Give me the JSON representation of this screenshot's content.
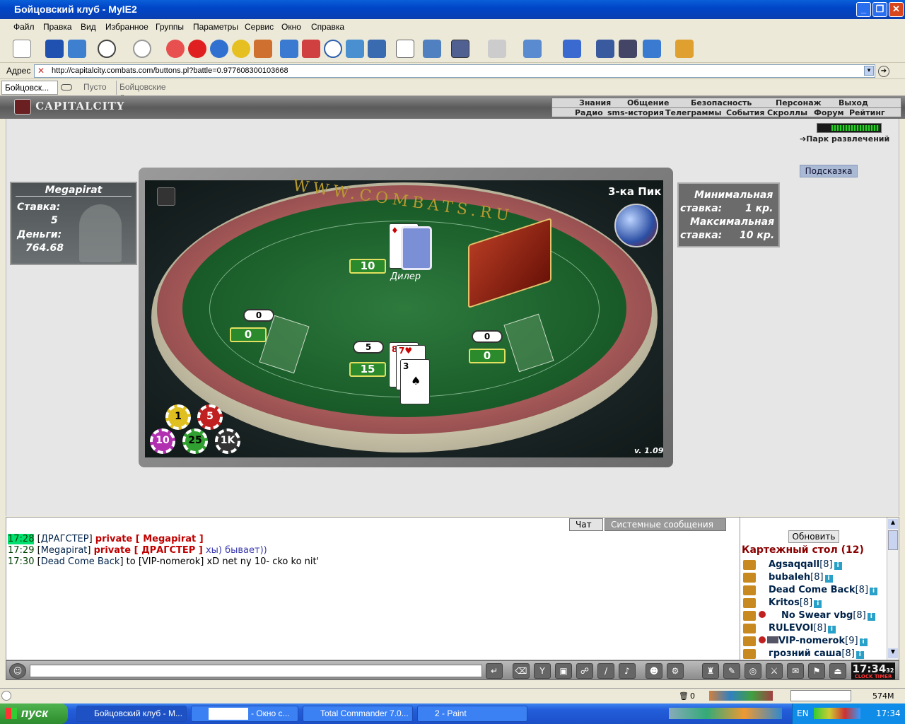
{
  "window": {
    "title": "Бойцовский клуб - MyIE2"
  },
  "menu": [
    "Файл",
    "Правка",
    "Вид",
    "Избранное",
    "Группы",
    "Параметры",
    "Сервис",
    "Окно",
    "Справка"
  ],
  "address": {
    "label": "Адрес",
    "url": "http://capitalcity.combats.com/buttons.pl?battle=0.977608300103668"
  },
  "tabs": [
    "Бойцовск...",
    "Пусто",
    "Бойцовские д..."
  ],
  "game": {
    "logo": "CAPITALCITY",
    "nav_top": [
      "Знания",
      "Общение",
      "Безопасность",
      "Персонаж",
      "Выход"
    ],
    "nav_bottom": [
      "Радио",
      "sms-история",
      "Телеграммы",
      "События",
      "Скроллы",
      "Форум",
      "Рейтинг"
    ],
    "park_link": "Парк развлечений",
    "hint_button": "Подсказка",
    "player": {
      "name": "Megapirat",
      "bet_label": "Ставка:",
      "bet": "5",
      "money_label": "Деньги:",
      "money": "764.68"
    },
    "limits": {
      "min_label1": "Минимальная",
      "min_label2": "ставка:",
      "min_value": "1 кр.",
      "max_label1": "Максимальная",
      "max_label2": "ставка:",
      "max_value": "10 кр."
    },
    "table_name": "3-ка Пик",
    "felt_text": "WWW.COMBATS.RU",
    "dealer_label": "Дилер",
    "dealer_score": "10",
    "left_seat": {
      "pill": "0",
      "bet": "0"
    },
    "right_seat": {
      "pill": "0",
      "bet": "0"
    },
    "center_seat": {
      "pill": "5",
      "bet": "15"
    },
    "chips": [
      "1",
      "5",
      "10",
      "25",
      "1K"
    ],
    "version": "v. 1.09"
  },
  "chat": {
    "tabs": [
      "Чат",
      "Системные сообщения"
    ],
    "lines": [
      {
        "time": "17:28",
        "nick": "ДРАГСТЕР",
        "private_to": "private [ Megapirat ]",
        "text": ""
      },
      {
        "time": "17:29",
        "nick": "Megapirat",
        "private_to": "private [ ДРАГСТЕР ]",
        "text": "хы) бывает))"
      },
      {
        "time": "17:30",
        "nick": "Dead Come Back",
        "private_to": "",
        "text": "to [VIP-nomerok] xD net ny 10- cko ko nit'"
      }
    ]
  },
  "users": {
    "refresh": "Обновить",
    "room": "Картежный стол (12)",
    "list": [
      {
        "name": "Agsaqqall",
        "level": "[8]"
      },
      {
        "name": "bubaleh",
        "level": "[8]"
      },
      {
        "name": "Dead Come Back",
        "level": "[8]"
      },
      {
        "name": "Kritos",
        "level": "[8]"
      },
      {
        "name": "No Swear vbg",
        "level": "[8]"
      },
      {
        "name": "RULEVOI",
        "level": "[8]"
      },
      {
        "name": "VIP-nomerok",
        "level": "[9]"
      },
      {
        "name": "грозний саша",
        "level": "[8]"
      }
    ]
  },
  "clock": {
    "time": "17:34",
    "sec": "32",
    "labels": "CLOCK TIMER"
  },
  "status": {
    "counter": "0",
    "memory": "574M"
  },
  "taskbar": {
    "start": "пуск",
    "items": [
      "Бойцовский клуб - M...",
      "- Окно с...",
      "Total Commander 7.0...",
      "2 - Paint"
    ],
    "lang": "EN",
    "time": "17:34"
  }
}
